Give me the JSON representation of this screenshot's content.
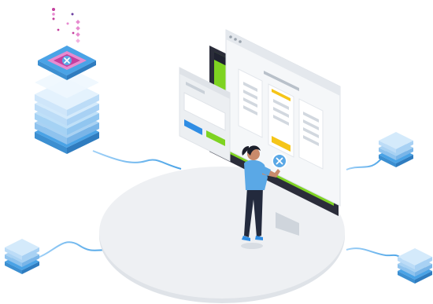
{
  "illustration": {
    "subject": "isometric-data-integration-scene",
    "icons": {
      "badge": "x-mark-icon",
      "bubble": "x-mark-icon"
    },
    "colors": {
      "background": "#ffffff",
      "platform": "#eef0f3",
      "platform_edge": "#dfe3e8",
      "stack_light": "#d9ecfb",
      "stack_mid": "#a9d2f3",
      "stack_dark": "#4aa3e6",
      "pink": "#e78bd0",
      "magenta": "#c43f9e",
      "monitor_bezel": "#2b2d3a",
      "screen_green": "#7ed321",
      "accent_blue": "#2f8de4",
      "accent_yellow": "#f5c518",
      "window_gray": "#eceff2",
      "shirt": "#5aa8e6",
      "pants": "#232a3d"
    }
  }
}
